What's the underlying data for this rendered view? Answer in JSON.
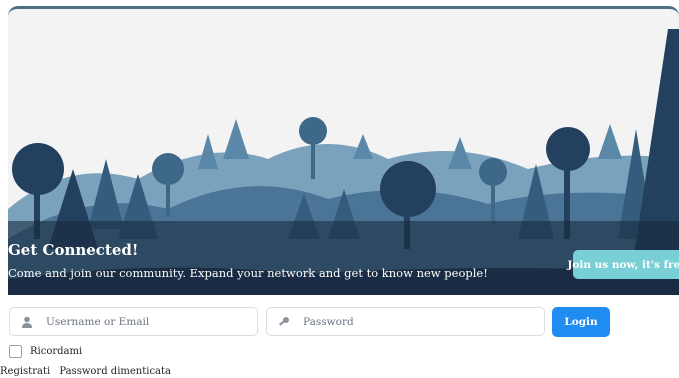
{
  "hero": {
    "title": "Get Connected!",
    "subtitle": "Come and join our community. Expand your network and get to know new people!",
    "cta_label": "Join us now, it's free!",
    "colors": {
      "sky": "#f3f3f3",
      "cta": "#79cfd6",
      "far_trees": "#4f7fa0",
      "mid_trees": "#355c7d",
      "near_trees": "#1d3352"
    }
  },
  "login_form": {
    "username_placeholder": "Username or Email",
    "username_icon": "user-icon",
    "password_placeholder": "Password",
    "password_icon": "key-icon",
    "login_label": "Login",
    "login_color": "#1e8cf0",
    "remember_label": "Ricordami",
    "register_link": "Registrati",
    "forgot_link": "Password dimenticata"
  }
}
